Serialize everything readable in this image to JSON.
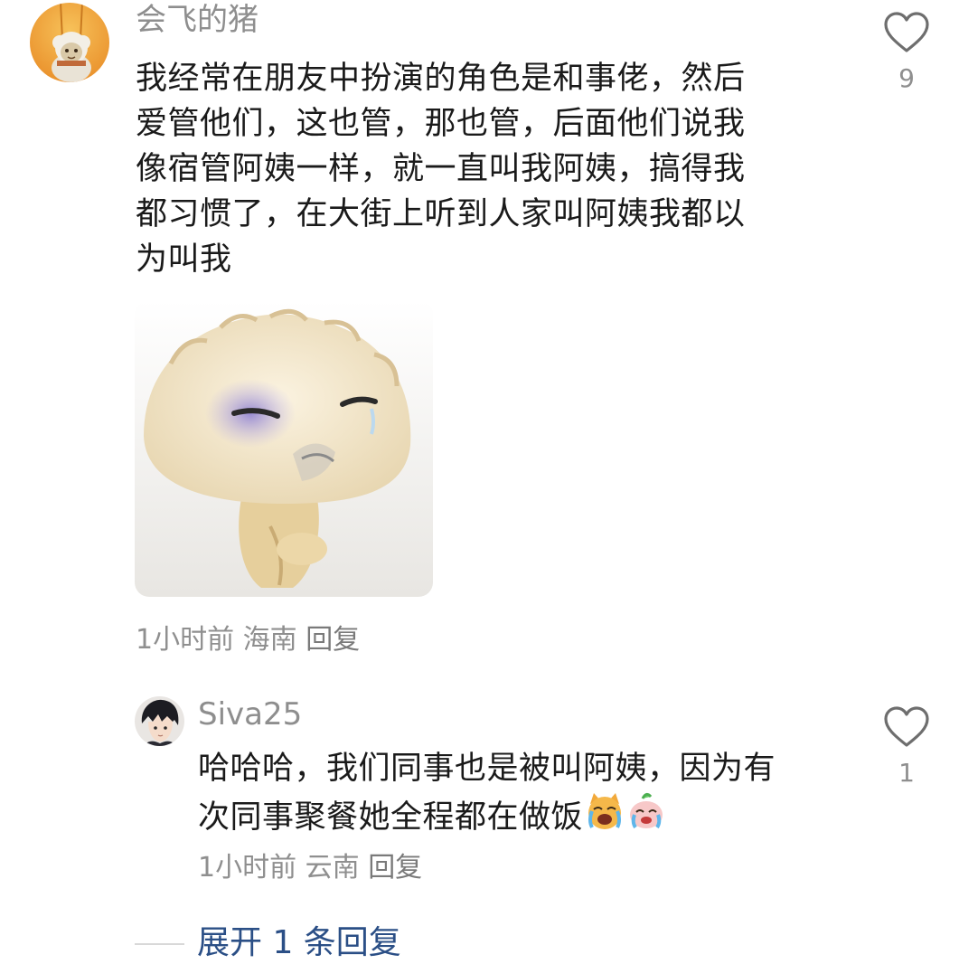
{
  "comment": {
    "username": "会飞的猪",
    "text": "我经常在朋友中扮演的角色是和事佬，然后爱管他们，这也管，那也管，后面他们说我像宿管阿姨一样，就一直叫我阿姨，搞得我都习惯了，在大街上听到人家叫阿姨我都以为叫我",
    "text_lines": [
      "我经常在朋友中扮演的角色是和事佬，然后",
      "爱管他们，这也管，那也管，后面他们说我",
      "像宿管阿姨一样，就一直叫我阿姨，搞得我",
      "都习惯了，在大街上听到人家叫阿姨我都以",
      "为叫我"
    ],
    "time": "1小时前",
    "location": "海南",
    "reply_label": "回复",
    "like_count": "9",
    "like_icon": "heart-outline-icon",
    "avatar_icon": "sheep-avatar"
  },
  "reply": {
    "username": "Siva25",
    "text_lines": [
      "哈哈哈，我们同事也是被叫阿姨，因为有",
      "次同事聚餐她全程都在做饭"
    ],
    "emojis": [
      "crying-cat-emoji",
      "crying-face-emoji"
    ],
    "time": "1小时前",
    "location": "云南",
    "reply_label": "回复",
    "like_count": "1",
    "like_icon": "heart-outline-icon",
    "avatar_icon": "anime-boy-avatar"
  },
  "expand": {
    "label": "展开 1 条回复"
  },
  "colors": {
    "username": "#8e8e8e",
    "meta": "#8f8f8f",
    "expand_link": "#2b4f86",
    "background": "#ffffff"
  }
}
